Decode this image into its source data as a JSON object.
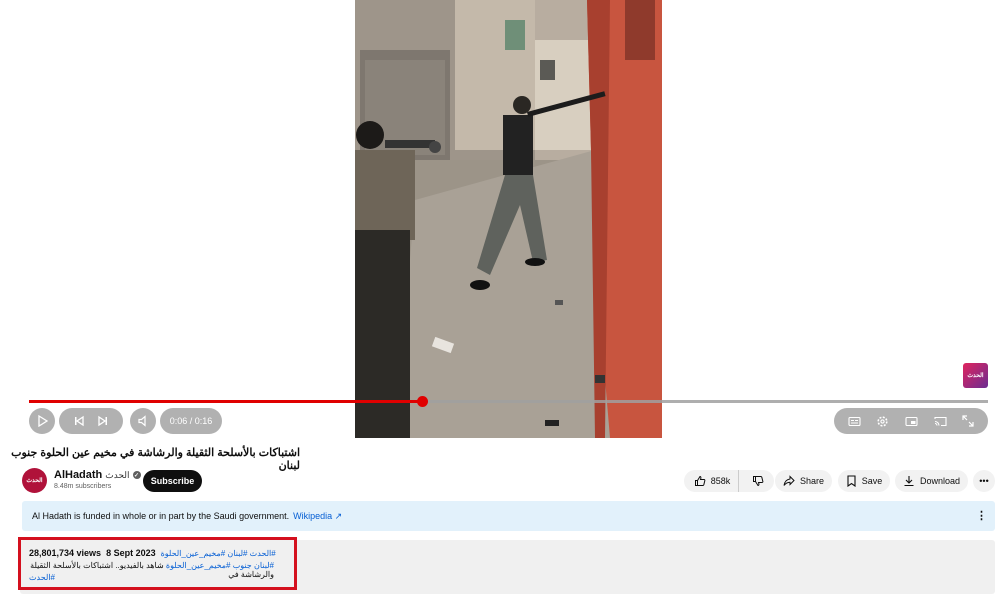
{
  "player": {
    "watermark_text": "الحدث",
    "time_display": "0:06 / 0:16",
    "progress_fraction": 0.41,
    "accent_color": "#e00000",
    "icons": [
      "play-icon",
      "previous-icon",
      "next-icon",
      "volume-icon",
      "subtitles-icon",
      "settings-icon",
      "miniplayer-icon",
      "cast-icon",
      "fullscreen-icon"
    ]
  },
  "video": {
    "title": "اشتباكات بالأسلحة الثقيلة والرشاشة في مخيم عين الحلوة جنوب لبنان"
  },
  "channel": {
    "avatar_text": "الحدث",
    "name": "AlHadath",
    "arabic_name": "الحدث",
    "subscribers": "8.48m subscribers",
    "subscribe_label": "Subscribe"
  },
  "actions": {
    "likes": "858k",
    "share_label": "Share",
    "save_label": "Save",
    "download_label": "Download",
    "more_label": "•••"
  },
  "info_banner": {
    "text": "Al Hadath is funded in whole or in part by the Saudi government.",
    "link_text": "Wikipedia ↗",
    "more_label": "⋮"
  },
  "description": {
    "views": "28,801,734 views",
    "date": "8 Sept 2023",
    "tags_line": "#الحدث #لبنان #مخيم_عين_الحلوة",
    "line2_prefix": "#لبنان جنوب ",
    "line2_tag": "#مخيم_عين_الحلوة",
    "line2_text": "شاهد بالفيديو.. اشتباكات بالأسلحة الثقيلة والرشاشة في",
    "line3": "#الحدث"
  }
}
